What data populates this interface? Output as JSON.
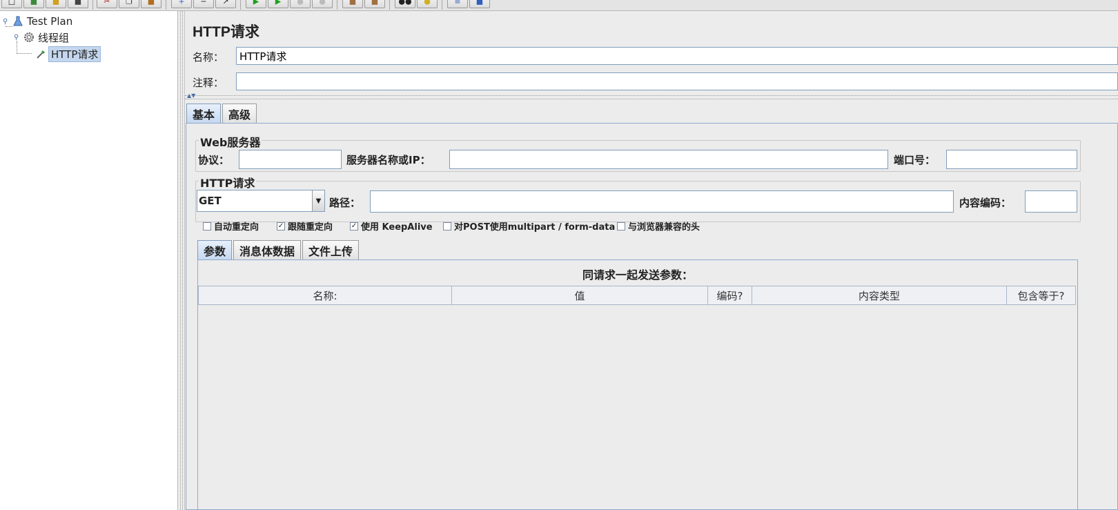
{
  "tree": {
    "items": [
      {
        "label": "Test Plan",
        "icon": "flask-icon"
      },
      {
        "label": "线程组",
        "icon": "gear-icon"
      },
      {
        "label": "HTTP请求",
        "icon": "pipette-icon"
      }
    ]
  },
  "panel": {
    "title": "HTTP请求",
    "name_label": "名称：",
    "name_value": "HTTP请求",
    "comment_label": "注释：",
    "comment_value": ""
  },
  "outer_tabs": [
    "基本",
    "高级"
  ],
  "web_server": {
    "title": "Web服务器",
    "protocol_label": "协议：",
    "protocol_value": "",
    "server_label": "服务器名称或IP：",
    "server_value": "",
    "port_label": "端口号：",
    "port_value": ""
  },
  "http_request": {
    "title": "HTTP请求",
    "method": "GET",
    "path_label": "路径：",
    "path_value": "",
    "encoding_label": "内容编码：",
    "encoding_value": ""
  },
  "options": [
    {
      "label": "自动重定向",
      "checked": false
    },
    {
      "label": "跟随重定向",
      "checked": true
    },
    {
      "label": "使用 KeepAlive",
      "checked": true
    },
    {
      "label": "对POST使用multipart / form-data",
      "checked": false
    },
    {
      "label": "与浏览器兼容的头",
      "checked": false
    }
  ],
  "inner_tabs": [
    "参数",
    "消息体数据",
    "文件上传"
  ],
  "params": {
    "caption": "同请求一起发送参数：",
    "columns": [
      "名称:",
      "值",
      "编码?",
      "内容类型",
      "包含等于?"
    ]
  },
  "colors": {
    "selection": "#c5d7ee",
    "accent_border": "#7f9db9",
    "panel_bg": "#ececec"
  }
}
